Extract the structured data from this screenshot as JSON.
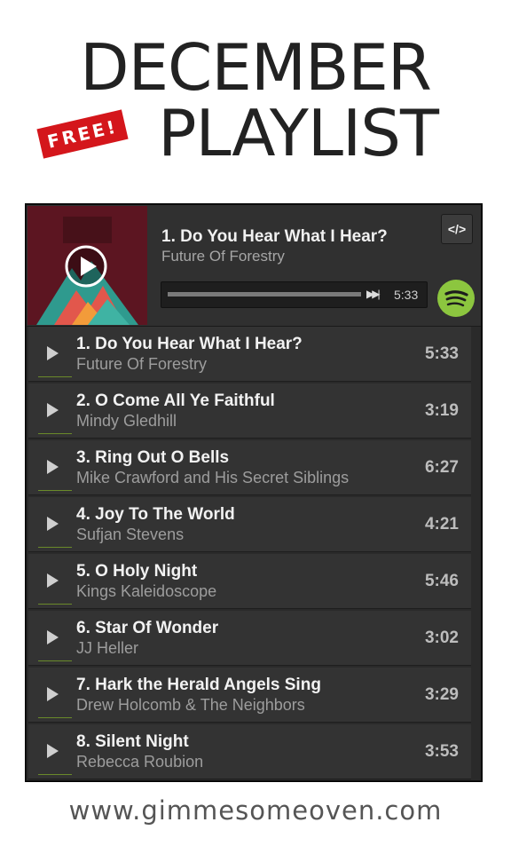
{
  "header": {
    "line1": "DECEMBER",
    "line2": "PLAYLIST",
    "badge": "FREE!"
  },
  "player": {
    "now_playing": {
      "title": "1. Do You Hear What I Hear?",
      "artist": "Future Of Forestry",
      "duration": "5:33",
      "progress": 0.0
    },
    "embed_label": "</>",
    "icons": {
      "play": "play-circle-icon",
      "skip": "skip-forward-icon",
      "brand": "spotify-icon",
      "embed": "code-embed-icon"
    },
    "accent_color": "#8cc63f"
  },
  "tracks": [
    {
      "title": "1. Do You Hear What I Hear?",
      "artist": "Future Of Forestry",
      "duration": "5:33"
    },
    {
      "title": "2. O Come All Ye Faithful",
      "artist": "Mindy Gledhill",
      "duration": "3:19"
    },
    {
      "title": "3. Ring Out O Bells",
      "artist": "Mike Crawford and His Secret Siblings",
      "duration": "6:27"
    },
    {
      "title": "4. Joy To The World",
      "artist": "Sufjan Stevens",
      "duration": "4:21"
    },
    {
      "title": "5. O Holy Night",
      "artist": "Kings Kaleidoscope",
      "duration": "5:46"
    },
    {
      "title": "6. Star Of Wonder",
      "artist": "JJ Heller",
      "duration": "3:02"
    },
    {
      "title": "7. Hark the Herald Angels Sing",
      "artist": "Drew Holcomb & The Neighbors",
      "duration": "3:29"
    },
    {
      "title": "8. Silent Night",
      "artist": "Rebecca Roubion",
      "duration": "3:53"
    }
  ],
  "footer": {
    "url": "www.gimmesomeoven.com"
  }
}
